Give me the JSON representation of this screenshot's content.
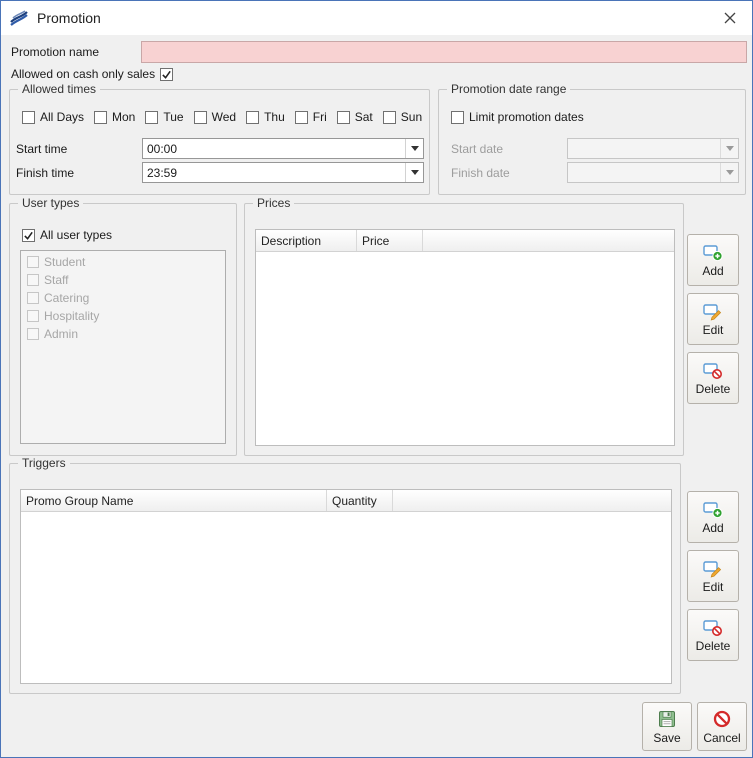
{
  "window": {
    "title": "Promotion"
  },
  "fields": {
    "promotion_name_label": "Promotion name",
    "promotion_name_value": "",
    "cash_only_label": "Allowed on cash only sales",
    "cash_only_checked": true
  },
  "allowed_times": {
    "title": "Allowed times",
    "days": [
      "All Days",
      "Mon",
      "Tue",
      "Wed",
      "Thu",
      "Fri",
      "Sat",
      "Sun"
    ],
    "start_time_label": "Start time",
    "start_time_value": "00:00",
    "finish_time_label": "Finish time",
    "finish_time_value": "23:59"
  },
  "date_range": {
    "title": "Promotion date range",
    "limit_label": "Limit promotion dates",
    "start_date_label": "Start date",
    "start_date_value": "",
    "finish_date_label": "Finish date",
    "finish_date_value": ""
  },
  "user_types": {
    "title": "User types",
    "all_label": "All user types",
    "all_checked": true,
    "items": [
      "Student",
      "Staff",
      "Catering",
      "Hospitality",
      "Admin"
    ]
  },
  "prices": {
    "title": "Prices",
    "columns": [
      "Description",
      "Price"
    ],
    "rows": [],
    "add_label": "Add",
    "edit_label": "Edit",
    "delete_label": "Delete"
  },
  "triggers": {
    "title": "Triggers",
    "columns": [
      "Promo Group Name",
      "Quantity"
    ],
    "rows": [],
    "add_label": "Add",
    "edit_label": "Edit",
    "delete_label": "Delete"
  },
  "footer": {
    "save_label": "Save",
    "cancel_label": "Cancel"
  },
  "colors": {
    "window_border": "#4a74b8",
    "invalid_field_bg": "#f8d2d2",
    "icon_blue": "#5b9bd5",
    "icon_green": "#2fa12f",
    "icon_red": "#d42a2a",
    "icon_orange": "#f0a830"
  }
}
